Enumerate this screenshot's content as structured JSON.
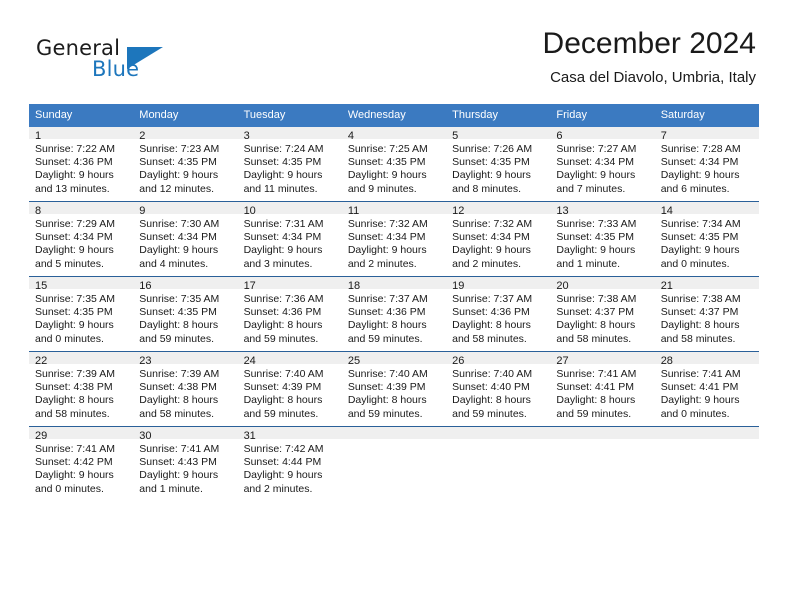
{
  "brand": {
    "name_part1": "General",
    "name_part2": "Blue",
    "flag_icon": "triangle-flag-icon",
    "accent_color": "#1d76bc"
  },
  "header": {
    "title": "December 2024",
    "subtitle": "Casa del Diavolo, Umbria, Italy"
  },
  "colors": {
    "header_row_bg": "#3b7ac1",
    "daynum_bg": "#efefef",
    "week_divider": "#2a6099",
    "text": "#1a1a1a"
  },
  "weekday_headers": [
    "Sunday",
    "Monday",
    "Tuesday",
    "Wednesday",
    "Thursday",
    "Friday",
    "Saturday"
  ],
  "weeks": [
    [
      {
        "day": "1",
        "sunrise": "Sunrise: 7:22 AM",
        "sunset": "Sunset: 4:36 PM",
        "daylight_1": "Daylight: 9 hours",
        "daylight_2": "and 13 minutes."
      },
      {
        "day": "2",
        "sunrise": "Sunrise: 7:23 AM",
        "sunset": "Sunset: 4:35 PM",
        "daylight_1": "Daylight: 9 hours",
        "daylight_2": "and 12 minutes."
      },
      {
        "day": "3",
        "sunrise": "Sunrise: 7:24 AM",
        "sunset": "Sunset: 4:35 PM",
        "daylight_1": "Daylight: 9 hours",
        "daylight_2": "and 11 minutes."
      },
      {
        "day": "4",
        "sunrise": "Sunrise: 7:25 AM",
        "sunset": "Sunset: 4:35 PM",
        "daylight_1": "Daylight: 9 hours",
        "daylight_2": "and 9 minutes."
      },
      {
        "day": "5",
        "sunrise": "Sunrise: 7:26 AM",
        "sunset": "Sunset: 4:35 PM",
        "daylight_1": "Daylight: 9 hours",
        "daylight_2": "and 8 minutes."
      },
      {
        "day": "6",
        "sunrise": "Sunrise: 7:27 AM",
        "sunset": "Sunset: 4:34 PM",
        "daylight_1": "Daylight: 9 hours",
        "daylight_2": "and 7 minutes."
      },
      {
        "day": "7",
        "sunrise": "Sunrise: 7:28 AM",
        "sunset": "Sunset: 4:34 PM",
        "daylight_1": "Daylight: 9 hours",
        "daylight_2": "and 6 minutes."
      }
    ],
    [
      {
        "day": "8",
        "sunrise": "Sunrise: 7:29 AM",
        "sunset": "Sunset: 4:34 PM",
        "daylight_1": "Daylight: 9 hours",
        "daylight_2": "and 5 minutes."
      },
      {
        "day": "9",
        "sunrise": "Sunrise: 7:30 AM",
        "sunset": "Sunset: 4:34 PM",
        "daylight_1": "Daylight: 9 hours",
        "daylight_2": "and 4 minutes."
      },
      {
        "day": "10",
        "sunrise": "Sunrise: 7:31 AM",
        "sunset": "Sunset: 4:34 PM",
        "daylight_1": "Daylight: 9 hours",
        "daylight_2": "and 3 minutes."
      },
      {
        "day": "11",
        "sunrise": "Sunrise: 7:32 AM",
        "sunset": "Sunset: 4:34 PM",
        "daylight_1": "Daylight: 9 hours",
        "daylight_2": "and 2 minutes."
      },
      {
        "day": "12",
        "sunrise": "Sunrise: 7:32 AM",
        "sunset": "Sunset: 4:34 PM",
        "daylight_1": "Daylight: 9 hours",
        "daylight_2": "and 2 minutes."
      },
      {
        "day": "13",
        "sunrise": "Sunrise: 7:33 AM",
        "sunset": "Sunset: 4:35 PM",
        "daylight_1": "Daylight: 9 hours",
        "daylight_2": "and 1 minute."
      },
      {
        "day": "14",
        "sunrise": "Sunrise: 7:34 AM",
        "sunset": "Sunset: 4:35 PM",
        "daylight_1": "Daylight: 9 hours",
        "daylight_2": "and 0 minutes."
      }
    ],
    [
      {
        "day": "15",
        "sunrise": "Sunrise: 7:35 AM",
        "sunset": "Sunset: 4:35 PM",
        "daylight_1": "Daylight: 9 hours",
        "daylight_2": "and 0 minutes."
      },
      {
        "day": "16",
        "sunrise": "Sunrise: 7:35 AM",
        "sunset": "Sunset: 4:35 PM",
        "daylight_1": "Daylight: 8 hours",
        "daylight_2": "and 59 minutes."
      },
      {
        "day": "17",
        "sunrise": "Sunrise: 7:36 AM",
        "sunset": "Sunset: 4:36 PM",
        "daylight_1": "Daylight: 8 hours",
        "daylight_2": "and 59 minutes."
      },
      {
        "day": "18",
        "sunrise": "Sunrise: 7:37 AM",
        "sunset": "Sunset: 4:36 PM",
        "daylight_1": "Daylight: 8 hours",
        "daylight_2": "and 59 minutes."
      },
      {
        "day": "19",
        "sunrise": "Sunrise: 7:37 AM",
        "sunset": "Sunset: 4:36 PM",
        "daylight_1": "Daylight: 8 hours",
        "daylight_2": "and 58 minutes."
      },
      {
        "day": "20",
        "sunrise": "Sunrise: 7:38 AM",
        "sunset": "Sunset: 4:37 PM",
        "daylight_1": "Daylight: 8 hours",
        "daylight_2": "and 58 minutes."
      },
      {
        "day": "21",
        "sunrise": "Sunrise: 7:38 AM",
        "sunset": "Sunset: 4:37 PM",
        "daylight_1": "Daylight: 8 hours",
        "daylight_2": "and 58 minutes."
      }
    ],
    [
      {
        "day": "22",
        "sunrise": "Sunrise: 7:39 AM",
        "sunset": "Sunset: 4:38 PM",
        "daylight_1": "Daylight: 8 hours",
        "daylight_2": "and 58 minutes."
      },
      {
        "day": "23",
        "sunrise": "Sunrise: 7:39 AM",
        "sunset": "Sunset: 4:38 PM",
        "daylight_1": "Daylight: 8 hours",
        "daylight_2": "and 58 minutes."
      },
      {
        "day": "24",
        "sunrise": "Sunrise: 7:40 AM",
        "sunset": "Sunset: 4:39 PM",
        "daylight_1": "Daylight: 8 hours",
        "daylight_2": "and 59 minutes."
      },
      {
        "day": "25",
        "sunrise": "Sunrise: 7:40 AM",
        "sunset": "Sunset: 4:39 PM",
        "daylight_1": "Daylight: 8 hours",
        "daylight_2": "and 59 minutes."
      },
      {
        "day": "26",
        "sunrise": "Sunrise: 7:40 AM",
        "sunset": "Sunset: 4:40 PM",
        "daylight_1": "Daylight: 8 hours",
        "daylight_2": "and 59 minutes."
      },
      {
        "day": "27",
        "sunrise": "Sunrise: 7:41 AM",
        "sunset": "Sunset: 4:41 PM",
        "daylight_1": "Daylight: 8 hours",
        "daylight_2": "and 59 minutes."
      },
      {
        "day": "28",
        "sunrise": "Sunrise: 7:41 AM",
        "sunset": "Sunset: 4:41 PM",
        "daylight_1": "Daylight: 9 hours",
        "daylight_2": "and 0 minutes."
      }
    ],
    [
      {
        "day": "29",
        "sunrise": "Sunrise: 7:41 AM",
        "sunset": "Sunset: 4:42 PM",
        "daylight_1": "Daylight: 9 hours",
        "daylight_2": "and 0 minutes."
      },
      {
        "day": "30",
        "sunrise": "Sunrise: 7:41 AM",
        "sunset": "Sunset: 4:43 PM",
        "daylight_1": "Daylight: 9 hours",
        "daylight_2": "and 1 minute."
      },
      {
        "day": "31",
        "sunrise": "Sunrise: 7:42 AM",
        "sunset": "Sunset: 4:44 PM",
        "daylight_1": "Daylight: 9 hours",
        "daylight_2": "and 2 minutes."
      },
      {
        "day": "",
        "sunrise": "",
        "sunset": "",
        "daylight_1": "",
        "daylight_2": ""
      },
      {
        "day": "",
        "sunrise": "",
        "sunset": "",
        "daylight_1": "",
        "daylight_2": ""
      },
      {
        "day": "",
        "sunrise": "",
        "sunset": "",
        "daylight_1": "",
        "daylight_2": ""
      },
      {
        "day": "",
        "sunrise": "",
        "sunset": "",
        "daylight_1": "",
        "daylight_2": ""
      }
    ]
  ]
}
